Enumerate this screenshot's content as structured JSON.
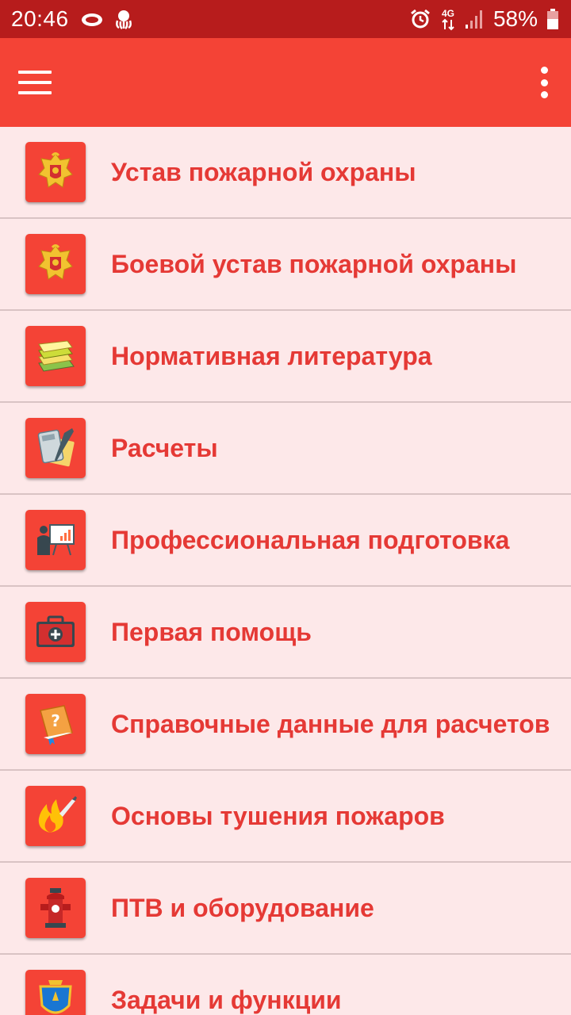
{
  "status_bar": {
    "time": "20:46",
    "network": "4G",
    "battery": "58%",
    "icons": [
      "cloud-icon",
      "octopus-icon",
      "alarm-icon",
      "signal-icon",
      "battery-icon"
    ]
  },
  "app_bar": {
    "icons": [
      "menu-icon",
      "overflow-menu-icon"
    ]
  },
  "menu": {
    "items": [
      {
        "label": "Устав пожарной охраны",
        "icon": "emblem-icon"
      },
      {
        "label": "Боевой устав пожарной охраны",
        "icon": "emblem-icon"
      },
      {
        "label": "Нормативная литература",
        "icon": "books-icon"
      },
      {
        "label": "Расчеты",
        "icon": "calculator-icon"
      },
      {
        "label": "Профессиональная подготовка",
        "icon": "presentation-icon"
      },
      {
        "label": "Первая помощь",
        "icon": "first-aid-kit-icon"
      },
      {
        "label": "Справочные данные для расчетов",
        "icon": "reference-book-icon"
      },
      {
        "label": "Основы тушения пожаров",
        "icon": "fire-icon"
      },
      {
        "label": "ПТВ и оборудование",
        "icon": "hydrant-icon"
      },
      {
        "label": "Задачи и функции",
        "icon": "shield-icon"
      }
    ]
  },
  "colors": {
    "status_bar": "#b71c1c",
    "app_bar": "#f44336",
    "background": "#fde8e9",
    "label_text": "#e53935",
    "divider": "#d9c3c4"
  }
}
